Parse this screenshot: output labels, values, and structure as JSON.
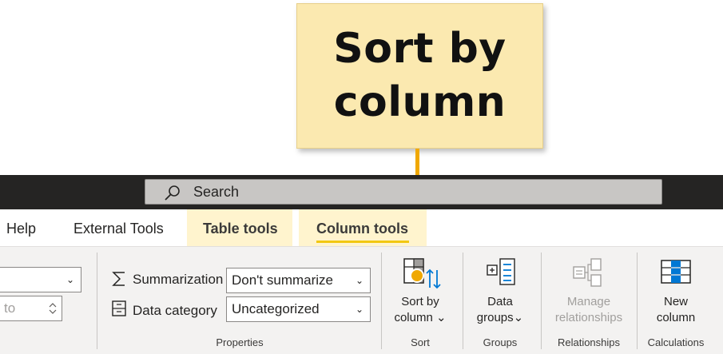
{
  "callout": {
    "line1": "Sort by",
    "line2": "column"
  },
  "titlebar": {
    "search_placeholder": "Search"
  },
  "tabs": [
    {
      "label": "Help"
    },
    {
      "label": "External Tools"
    },
    {
      "label": "Table tools"
    },
    {
      "label": "Column tools"
    }
  ],
  "properties": {
    "format_value": "",
    "decimals_value": "to",
    "summarization_label": "Summarization",
    "summarization_value": "Don't summarize",
    "data_category_label": "Data category",
    "data_category_value": "Uncategorized",
    "group_label": "Properties"
  },
  "sort": {
    "line1": "Sort by",
    "line2": "column",
    "group_label": "Sort"
  },
  "groups": {
    "line1": "Data",
    "line2": "groups",
    "group_label": "Groups"
  },
  "relationships": {
    "line1": "Manage",
    "line2": "relationships",
    "group_label": "Relationships"
  },
  "calculations": {
    "line1": "New",
    "line2": "column",
    "group_label": "Calculations"
  },
  "colors": {
    "accent": "#f2c811",
    "callout_fill": "#fbe9b0",
    "leader": "#f0a800",
    "titlebar": "#252423"
  }
}
